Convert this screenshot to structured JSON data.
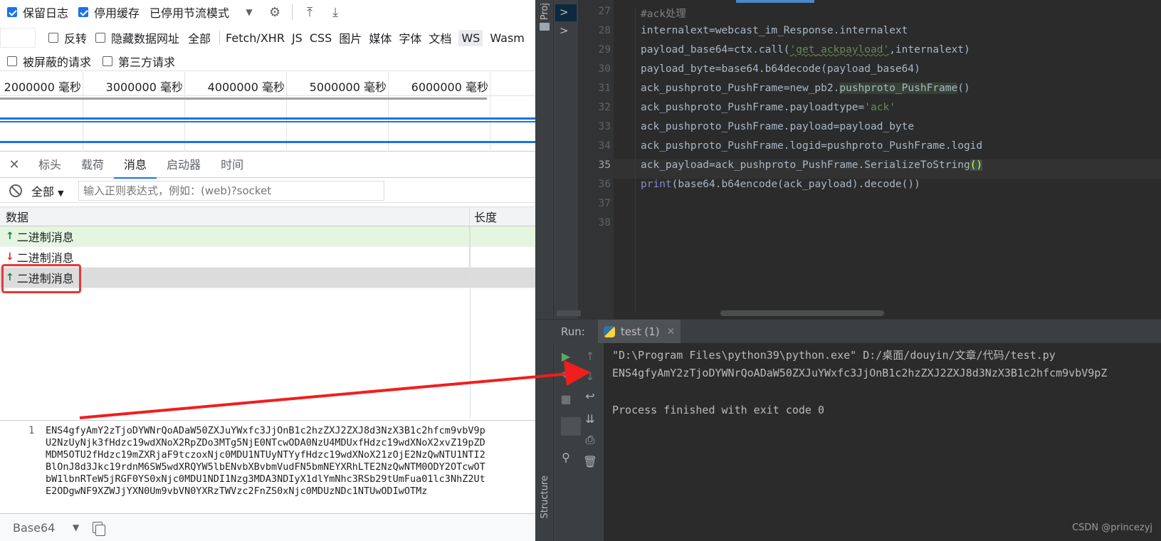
{
  "devtools": {
    "toolbar": {
      "preserve_log": "保留日志",
      "disable_cache": "停用缓存",
      "throttling": "已停用节流模式"
    },
    "filters": {
      "invert": "反转",
      "hide_data_urls": "隐藏数据网址",
      "all": "全部",
      "types": [
        "Fetch/XHR",
        "JS",
        "CSS",
        "图片",
        "媒体",
        "字体",
        "文档",
        "WS",
        "Wasm"
      ],
      "blocked_requests": "被屏蔽的请求",
      "third_party": "第三方请求"
    },
    "timeline": {
      "ticks": [
        "2000000 毫秒",
        "3000000 毫秒",
        "4000000 毫秒",
        "5000000 毫秒",
        "6000000 毫秒"
      ]
    },
    "tabs": [
      "标头",
      "载荷",
      "消息",
      "启动器",
      "时间"
    ],
    "active_tab": "消息",
    "message_filter": {
      "select": "全部",
      "placeholder": "输入正则表达式，例如：(web)?socket"
    },
    "table": {
      "col_data": "数据",
      "col_length": "长度",
      "rows": [
        {
          "dir": "up",
          "text": "二进制消息"
        },
        {
          "dir": "down",
          "text": "二进制消息"
        },
        {
          "dir": "up",
          "text": "二进制消息"
        }
      ]
    },
    "detail": {
      "line_number": "1",
      "lines": [
        "ENS4gfyAmY2zTjoDYWNrQoADaW50ZXJuYWxfc3JjOnB1c2hzZXJ2ZXJ8d3NzX3B1c2hfcm9vbV9p",
        "U2NzUyNjk3fHdzc19wdXNoX2RpZDo3MTg5NjE0NTcwODA0NzU4MDUxfHdzc19wdXNoX2xvZ19pZD",
        "MDM5OTU2fHdzc19mZXRjaF9tczoxNjc0MDU1NTUyNTYyfHdzc19wdXNoX21zOjE2NzQwNTU1NTI2",
        "BlOnJ8d3Jkc19rdnM6SW5wdXRQYW5lbENvbXBvbmVudFN5bmNEYXRhLTE2NzQwNTM0ODY2OTcwOT",
        "bW1lbnRTeW5jRGF0YS0xNjc0MDU1NDI1Nzg3MDA3NDIyX1dlYmNhc3RSb29tUmFua01lc3NhZ2Ut",
        "E2ODgwNF9XZWJjYXN0Um9vbVN0YXRzTWVzc2FnZS0xNjc0MDUzNDc1NTUwODIwOTMz"
      ],
      "format": "Base64"
    }
  },
  "ide": {
    "project_label": "Proj",
    "structure_label": "Structure",
    "line_numbers": [
      "27",
      "28",
      "29",
      "30",
      "31",
      "32",
      "33",
      "34",
      "35",
      "36",
      "37",
      "38"
    ],
    "code": {
      "l27": "#ack处理",
      "l28": "internalext=webcast_im_Response.internalext",
      "l29_a": "payload_base64=ctx.call(",
      "l29_s": "'get_ackpayload'",
      "l29_b": ",internalext)",
      "l30": "payload_byte=base64.b64decode(payload_base64)",
      "l31_a": "ack_pushproto_PushFrame=new_pb2.",
      "l31_h": "pushproto_PushFrame",
      "l31_b": "()",
      "l32_a": "ack_pushproto_PushFrame.payloadtype=",
      "l32_s": "'ack'",
      "l33": "ack_pushproto_PushFrame.payload=payload_byte",
      "l34": "ack_pushproto_PushFrame.logid=pushproto_PushFrame.logid",
      "l35_a": "ack_payload=ack_pushproto_PushFrame.SerializeToString",
      "l35_p": "()",
      "l36_kw": "print",
      "l36_b": "(base64.b64encode(ack_payload).decode())"
    },
    "run": {
      "label": "Run:",
      "tab": "test (1)",
      "cmd": "\"D:\\Program Files\\python39\\python.exe\" D:/桌面/douyin/文章/代码/test.py",
      "output": "ENS4gfyAmY2zTjoDYWNrQoADaW50ZXJuYWxfc3JjOnB1c2hzZXJ2ZXJ8d3NzX3B1c2hfcm9vbV9pZ",
      "exit": "Process finished with exit code 0"
    },
    "watermark": "CSDN @princezyj"
  },
  "colors": {
    "annotation": "#e53935",
    "ide_bg": "#2b2b2b",
    "accent": "#1a73e8"
  }
}
